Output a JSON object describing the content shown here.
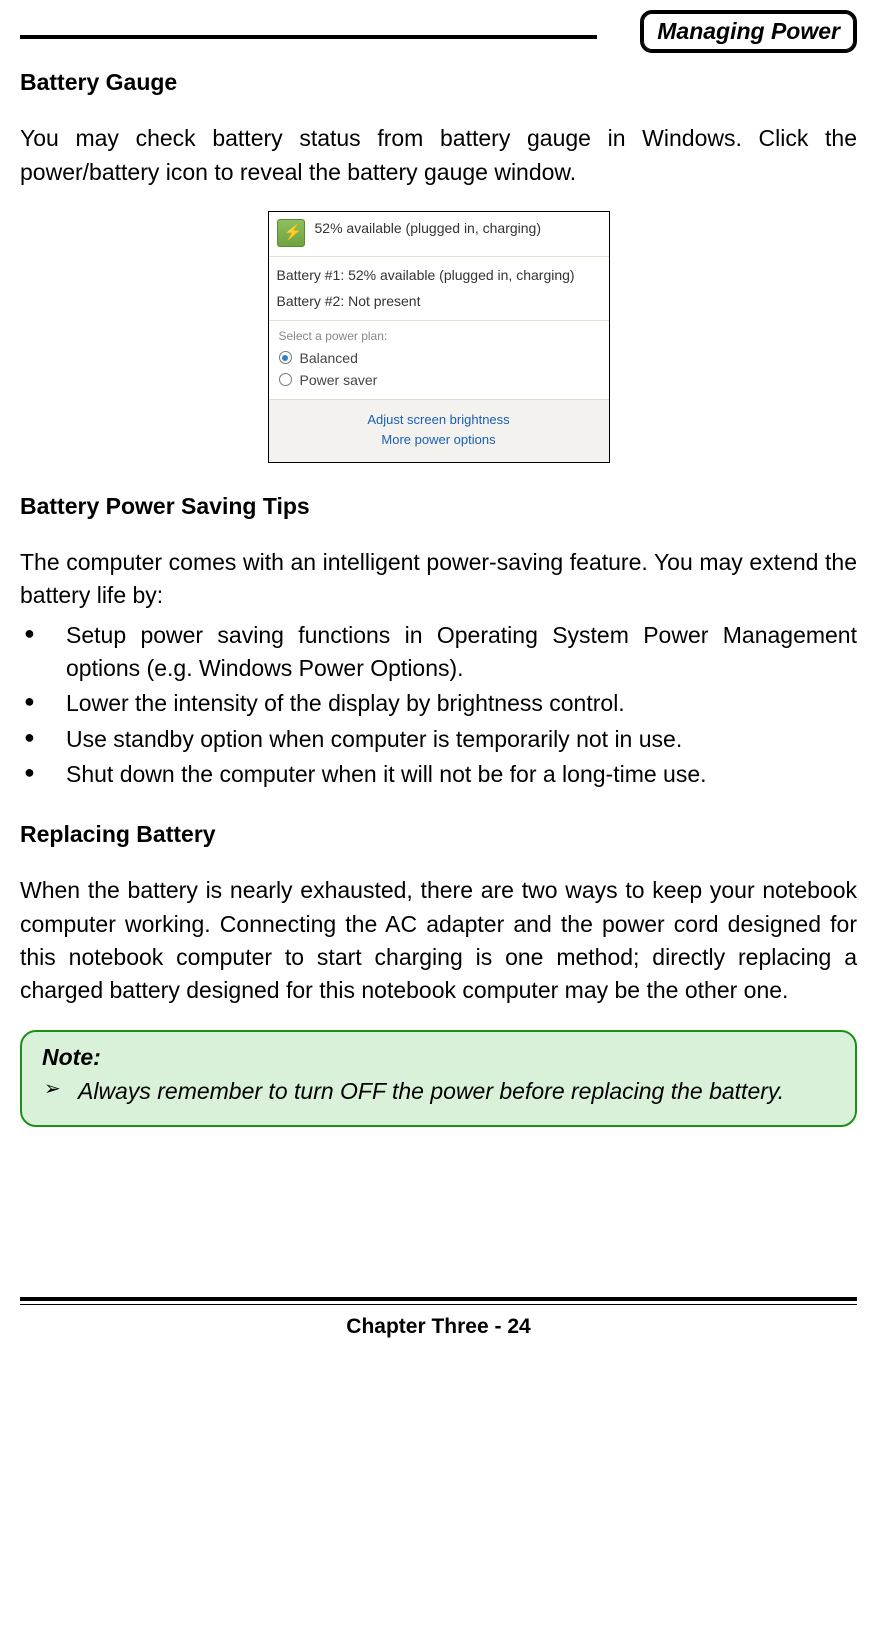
{
  "header": {
    "badge": "Managing Power"
  },
  "s1": {
    "title": "Battery Gauge",
    "para": "You may check battery status from battery gauge in Windows. Click the power/battery icon to reveal the battery gauge window."
  },
  "gauge": {
    "summary": "52% available (plugged in, charging)",
    "bat1": "Battery #1: 52% available (plugged in, charging)",
    "bat2": "Battery #2: Not present",
    "plan_label": "Select a power plan:",
    "plan_balanced": "Balanced",
    "plan_saver": "Power saver",
    "link1": "Adjust screen brightness",
    "link2": "More power options"
  },
  "s2": {
    "title": "Battery Power Saving Tips",
    "intro": "The computer comes with an intelligent power-saving feature. You may extend the battery life by:",
    "tips": [
      "Setup power saving functions in Operating System Power Management options (e.g. Windows Power Options).",
      "Lower the intensity of the display by brightness control.",
      "Use standby option when computer is temporarily not in use.",
      "Shut down the computer when it will not be for a long-time use."
    ]
  },
  "s3": {
    "title": "Replacing Battery",
    "para": "When the battery is nearly exhausted, there are two ways to keep your notebook computer working. Connecting the AC adapter and the power cord designed for this notebook computer to start charging is one method; directly replacing a charged battery designed for this notebook computer may be the other one."
  },
  "note": {
    "title": "Note:",
    "body": "Always remember to turn OFF the power before replacing the battery."
  },
  "footer": {
    "page": "Chapter Three - 24"
  }
}
